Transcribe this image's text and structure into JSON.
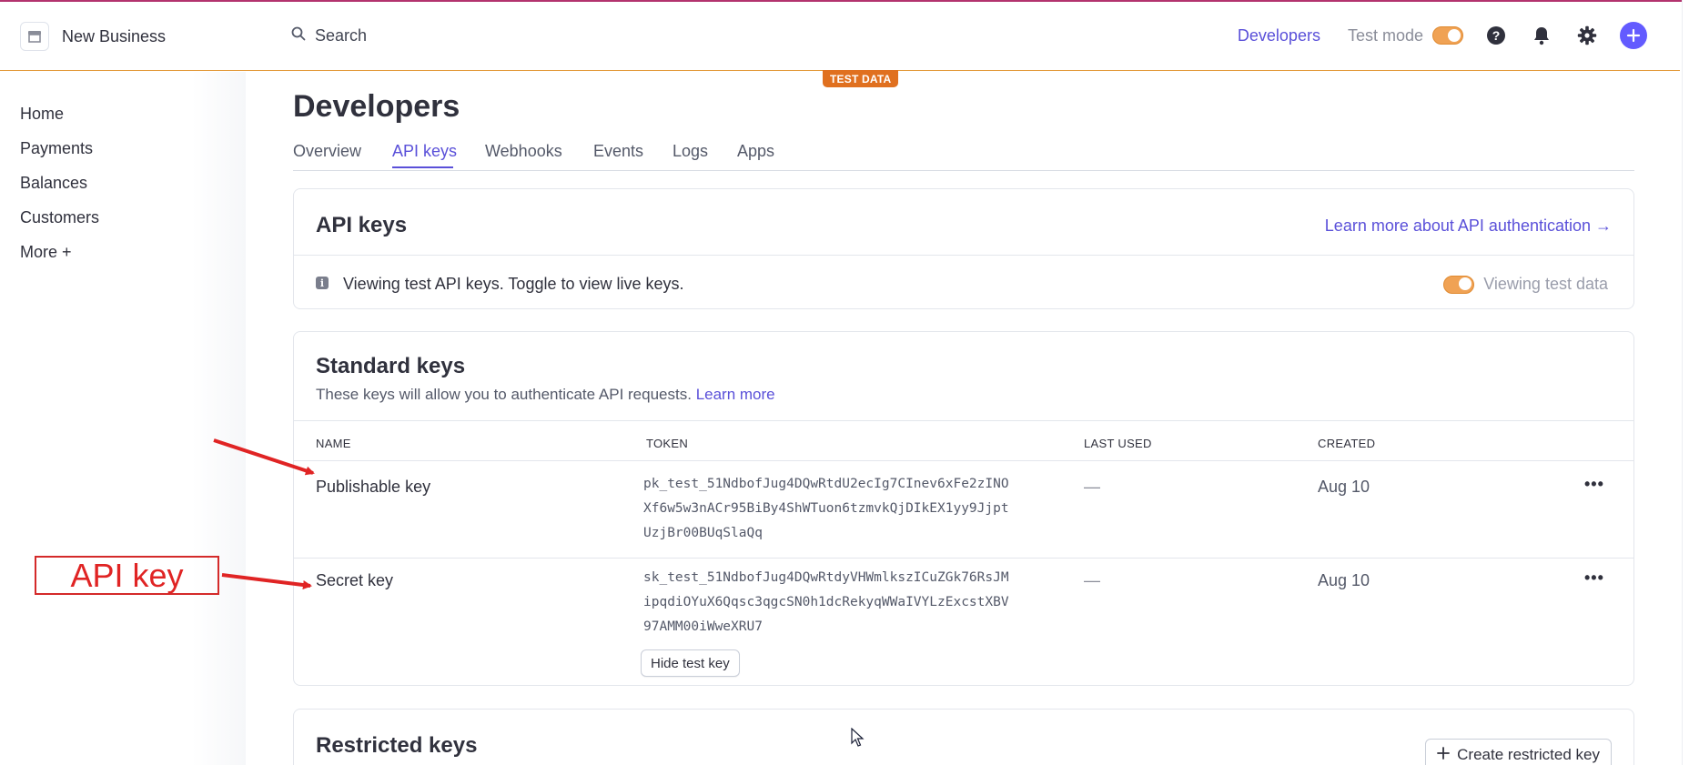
{
  "header": {
    "business_name": "New Business",
    "search_placeholder": "Search",
    "developers_link": "Developers",
    "test_mode_label": "Test mode",
    "test_mode_on": true,
    "icons": [
      "help-icon",
      "bell-icon",
      "gear-icon",
      "plus-icon"
    ]
  },
  "badge": {
    "test_data": "TEST DATA"
  },
  "sidebar": {
    "items": [
      {
        "label": "Home"
      },
      {
        "label": "Payments"
      },
      {
        "label": "Balances"
      },
      {
        "label": "Customers"
      },
      {
        "label": "More +"
      }
    ]
  },
  "page": {
    "title": "Developers",
    "tabs": [
      {
        "label": "Overview",
        "active": false
      },
      {
        "label": "API keys",
        "active": true
      },
      {
        "label": "Webhooks",
        "active": false
      },
      {
        "label": "Events",
        "active": false
      },
      {
        "label": "Logs",
        "active": false
      },
      {
        "label": "Apps",
        "active": false
      }
    ]
  },
  "api_keys_card": {
    "title": "API keys",
    "learn_link": "Learn more about API authentication →",
    "info_text": "Viewing test API keys. Toggle to view live keys.",
    "toggle_label": "Viewing test data"
  },
  "standard_keys": {
    "title": "Standard keys",
    "subtitle": "These keys will allow you to authenticate API requests.",
    "subtitle_link": "Learn more",
    "columns": [
      "NAME",
      "TOKEN",
      "LAST USED",
      "CREATED"
    ],
    "rows": [
      {
        "name": "Publishable key",
        "token_lines": [
          "pk_test_51NdbofJug4DQwRtdU2ecIg7CInev6xFe2zINO",
          "Xf6w5w3nACr95BiBy4ShWTuon6tzmvkQjDIkEX1yy9Jjpt",
          "UzjBr00BUqSlaQq"
        ],
        "last_used": "—",
        "created": "Aug 10",
        "more": "•••"
      },
      {
        "name": "Secret key",
        "token_lines": [
          "sk_test_51NdbofJug4DQwRtdyVHWmlkszICuZGk76RsJM",
          "ipqdiOYuX6Qqsc3qgcSN0h1dcRekyqWWaIVYLzExcstXBV",
          "97AMM00iWweXRU7"
        ],
        "last_used": "—",
        "created": "Aug 10",
        "more": "•••"
      }
    ],
    "hide_button": "Hide test key"
  },
  "restricted_keys": {
    "title": "Restricted keys",
    "create_button": "Create restricted key"
  },
  "annotation": {
    "label": "API key",
    "color": "#e02424"
  }
}
